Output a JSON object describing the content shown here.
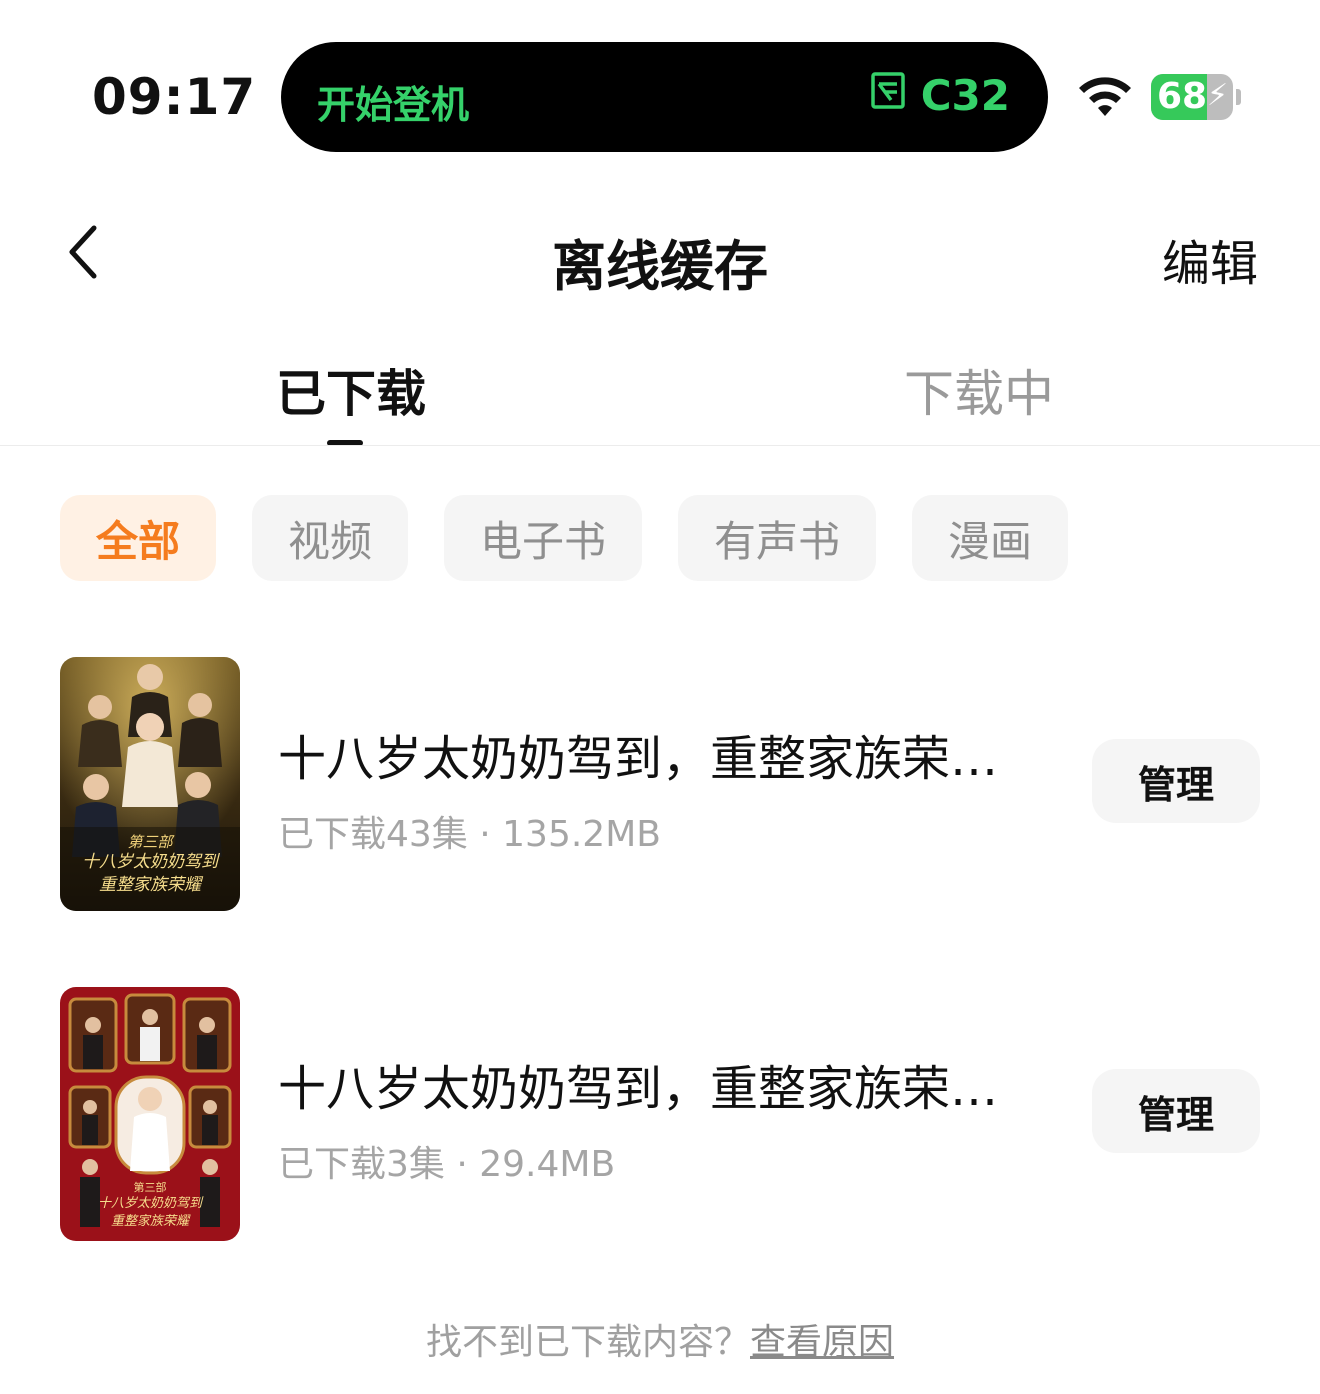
{
  "status_bar": {
    "time": "09:17",
    "island": {
      "left_text": "开始登机",
      "right_text": "C32",
      "icon": "gate-icon",
      "accent": "#35d16a"
    },
    "battery_level": "68",
    "battery_fraction": 0.68,
    "charging": true
  },
  "header": {
    "title": "离线缓存",
    "edit_label": "编辑",
    "back_icon": "chevron-left-icon"
  },
  "tabs": [
    {
      "label": "已下载",
      "active": true
    },
    {
      "label": "下载中",
      "active": false
    }
  ],
  "filters": [
    {
      "label": "全部",
      "active": true
    },
    {
      "label": "视频",
      "active": false
    },
    {
      "label": "电子书",
      "active": false
    },
    {
      "label": "有声书",
      "active": false
    },
    {
      "label": "漫画",
      "active": false
    }
  ],
  "items": [
    {
      "title": "十八岁太奶奶驾到，重整家族荣…",
      "meta": "已下载43集 · 135.2MB",
      "manage_label": "管理",
      "poster_theme": "gold"
    },
    {
      "title": "十八岁太奶奶驾到，重整家族荣…",
      "meta": "已下载3集 · 29.4MB",
      "manage_label": "管理",
      "poster_theme": "red"
    }
  ],
  "footer": {
    "text": "找不到已下载内容？",
    "link": "查看原因"
  },
  "colors": {
    "accent_orange": "#f57c1e",
    "chip_active_bg": "#fff1e4",
    "chip_bg": "#f5f5f5"
  }
}
